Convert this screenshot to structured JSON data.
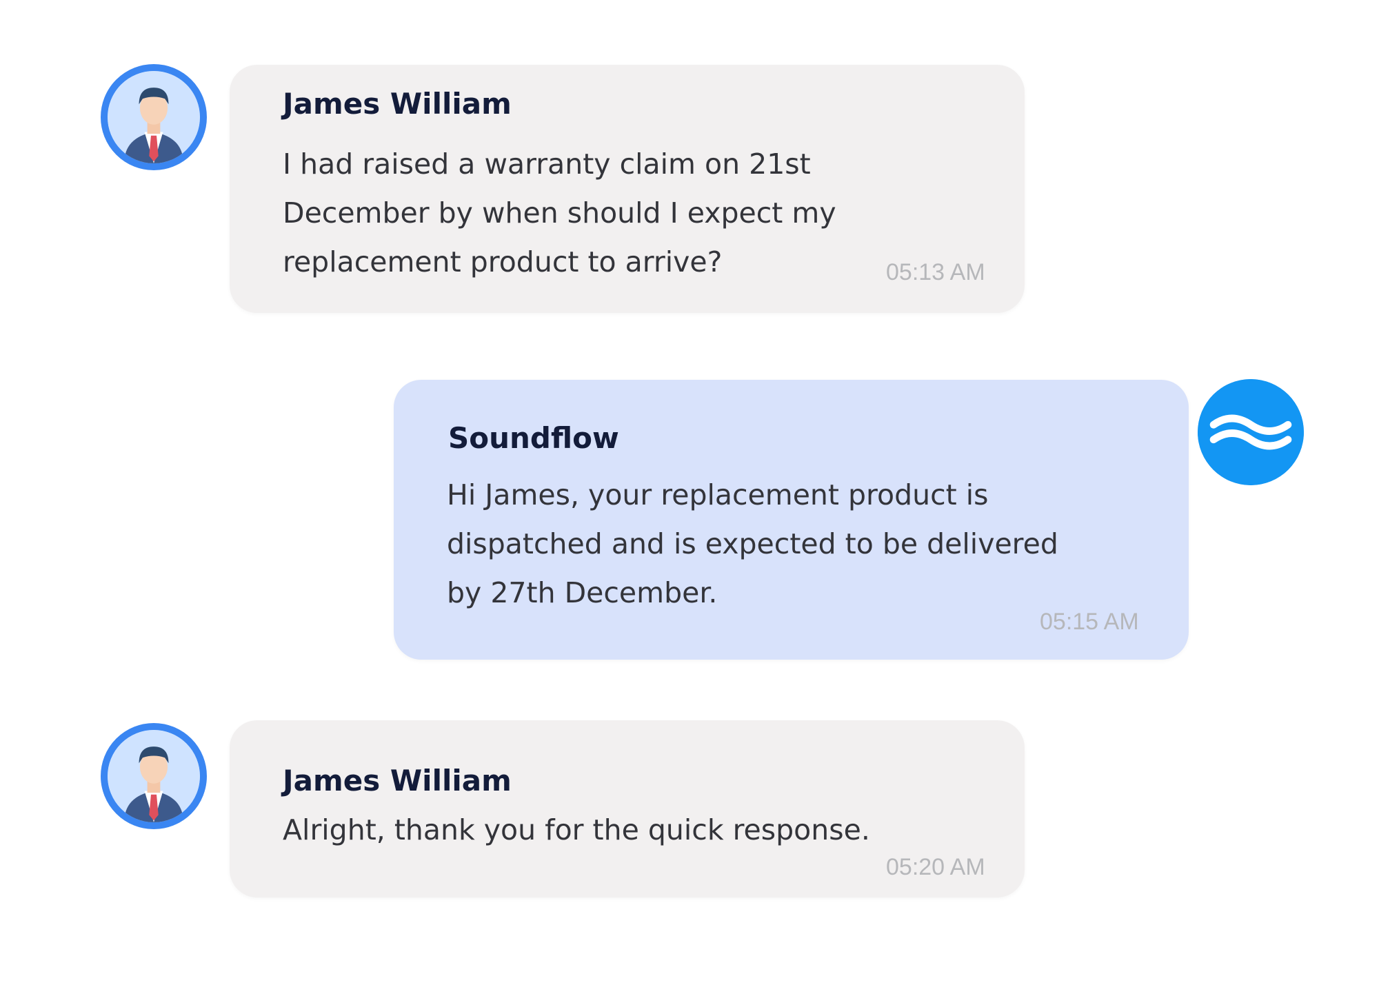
{
  "colors": {
    "incoming_bubble": "#f2f0f0",
    "outgoing_bubble": "#d8e2fb",
    "avatar_ring": "#3a86f2",
    "brand_avatar": "#1396f3",
    "sender_text": "#131c3a",
    "message_text": "#33343a",
    "timestamp_text": "#b6b7ba"
  },
  "messages": [
    {
      "direction": "incoming",
      "avatar_icon": "businessman-avatar-icon",
      "sender": "James William",
      "lines": [
        "I had raised a warranty claim on 21st",
        "December by when should I expect my",
        "replacement product to arrive?"
      ],
      "time": "05:13 AM"
    },
    {
      "direction": "outgoing",
      "avatar_icon": "soundflow-wave-logo-icon",
      "sender": "Soundflow",
      "lines": [
        "Hi James, your replacement product is",
        "dispatched and is expected to be delivered",
        "by 27th December."
      ],
      "time": "05:15 AM"
    },
    {
      "direction": "incoming",
      "avatar_icon": "businessman-avatar-icon",
      "sender": "James William",
      "lines": [
        "Alright, thank you for the quick response."
      ],
      "time": "05:20 AM"
    }
  ]
}
